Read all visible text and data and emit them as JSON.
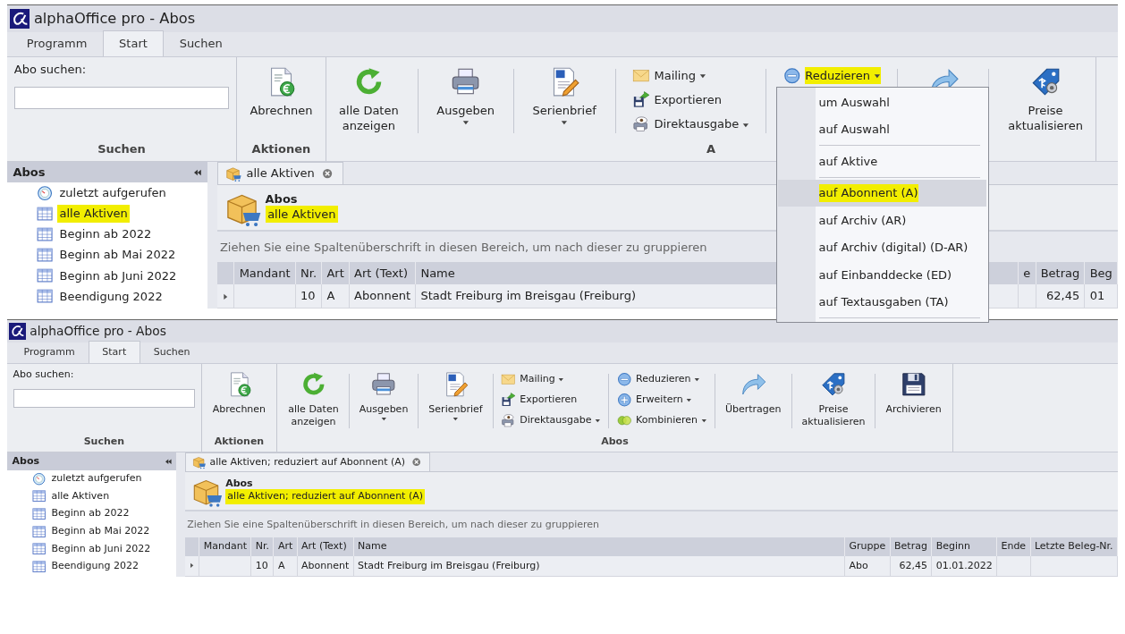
{
  "screenshots": [
    {
      "title": "alphaOffice pro - Abos",
      "tabs": [
        {
          "label": "Programm",
          "selected": false
        },
        {
          "label": "Start",
          "selected": true
        },
        {
          "label": "Suchen",
          "selected": false
        }
      ],
      "ribbon_groups": [
        {
          "label": "Suchen",
          "kind": "search",
          "field_label": "Abo suchen:"
        },
        {
          "label": "Aktionen",
          "kind": "buttons",
          "sections": [
            {
              "kind": "large",
              "label": "Abrechnen",
              "dropdown": false
            }
          ]
        },
        {
          "label": "A",
          "kind": "buttons",
          "sections": [
            {
              "kind": "large",
              "label": "alle Daten\nanzeigen",
              "dropdown": false
            },
            {
              "kind": "large",
              "label": "Ausgeben",
              "dropdown": true
            },
            {
              "kind": "large",
              "label": "Serienbrief",
              "dropdown": true
            },
            {
              "kind": "small_stack",
              "items": [
                {
                  "label": "Mailing",
                  "dropdown": true,
                  "highlighted": false
                },
                {
                  "label": "Exportieren",
                  "dropdown": false,
                  "highlighted": false
                },
                {
                  "label": "Direktausgabe",
                  "dropdown": true,
                  "highlighted": false
                }
              ]
            },
            {
              "kind": "small_stack",
              "items": [
                {
                  "label": "Reduzieren",
                  "dropdown": true,
                  "highlighted": true,
                  "menu": [
                    {
                      "kind": "item",
                      "label": "um Auswahl",
                      "selected": false,
                      "highlighted": false
                    },
                    {
                      "kind": "item",
                      "label": "auf Auswahl",
                      "selected": false,
                      "highlighted": false
                    },
                    {
                      "kind": "separator"
                    },
                    {
                      "kind": "item",
                      "label": "auf Aktive",
                      "selected": false,
                      "highlighted": false
                    },
                    {
                      "kind": "separator"
                    },
                    {
                      "kind": "item",
                      "label": "auf Abonnent (A)",
                      "selected": true,
                      "highlighted": true
                    },
                    {
                      "kind": "item",
                      "label": "auf Archiv (AR)",
                      "selected": false,
                      "highlighted": false
                    },
                    {
                      "kind": "item",
                      "label": "auf Archiv (digital) (D-AR)",
                      "selected": false,
                      "highlighted": false
                    },
                    {
                      "kind": "item",
                      "label": "auf Einbanddecke (ED)",
                      "selected": false,
                      "highlighted": false
                    },
                    {
                      "kind": "item",
                      "label": "auf Textausgaben (TA)",
                      "selected": false,
                      "highlighted": false
                    },
                    {
                      "kind": "separator"
                    }
                  ]
                }
              ]
            },
            {
              "kind": "large",
              "dropdown": false
            },
            {
              "kind": "large",
              "label": "Preise\naktualisieren",
              "dropdown": false
            }
          ]
        }
      ],
      "sidebar": {
        "title": "Abos",
        "items": [
          {
            "kind": "recent",
            "label": "zuletzt aufgerufen",
            "highlighted": false
          },
          {
            "kind": "view",
            "label": "alle Aktiven",
            "highlighted": true
          },
          {
            "kind": "view",
            "label": "Beginn ab 2022",
            "highlighted": false
          },
          {
            "kind": "view",
            "label": "Beginn ab Mai 2022",
            "highlighted": false
          },
          {
            "kind": "view",
            "label": "Beginn ab Juni 2022",
            "highlighted": false
          },
          {
            "kind": "view",
            "label": "Beendigung 2022",
            "highlighted": false
          }
        ]
      },
      "document_tab": {
        "label": "alle Aktiven"
      },
      "header": {
        "title": "Abos",
        "subtitle": "alle Aktiven",
        "highlighted": true
      },
      "group_hint": "Ziehen Sie eine Spaltenüberschrift in diesen Bereich, um nach dieser zu gruppieren",
      "table": {
        "columns": [
          {
            "label": "Mandant"
          },
          {
            "label": "Nr."
          },
          {
            "label": "Art"
          },
          {
            "label": "Art (Text)"
          },
          {
            "label": "Name"
          },
          {
            "label": "e"
          },
          {
            "label": "Betrag",
            "numeric": true
          },
          {
            "label": "Beg"
          }
        ],
        "rows": [
          {
            "current": true,
            "cells": [
              null,
              "10",
              "A",
              "Abonnent",
              "Stadt Freiburg im Breisgau (Freiburg)",
              null,
              "62,45",
              "01"
            ]
          }
        ]
      }
    },
    {
      "title": "alphaOffice pro - Abos",
      "tabs": [
        {
          "label": "Programm",
          "selected": false
        },
        {
          "label": "Start",
          "selected": true
        },
        {
          "label": "Suchen",
          "selected": false
        }
      ],
      "ribbon_groups": [
        {
          "label": "Suchen",
          "kind": "search",
          "field_label": "Abo suchen:"
        },
        {
          "label": "Aktionen",
          "kind": "buttons",
          "sections": [
            {
              "kind": "large",
              "label": "Abrechnen",
              "dropdown": false
            }
          ]
        },
        {
          "label": "Abos",
          "kind": "buttons",
          "sections": [
            {
              "kind": "large",
              "label": "alle Daten\nanzeigen",
              "dropdown": false
            },
            {
              "kind": "large",
              "label": "Ausgeben",
              "dropdown": true
            },
            {
              "kind": "large",
              "label": "Serienbrief",
              "dropdown": true
            },
            {
              "kind": "small_stack",
              "items": [
                {
                  "label": "Mailing",
                  "dropdown": true,
                  "highlighted": false
                },
                {
                  "label": "Exportieren",
                  "dropdown": false,
                  "highlighted": false
                },
                {
                  "label": "Direktausgabe",
                  "dropdown": true,
                  "highlighted": false
                }
              ]
            },
            {
              "kind": "small_stack",
              "items": [
                {
                  "label": "Reduzieren",
                  "dropdown": true,
                  "highlighted": false
                },
                {
                  "label": "Erweitern",
                  "dropdown": true,
                  "highlighted": false
                },
                {
                  "label": "Kombinieren",
                  "dropdown": true,
                  "highlighted": false
                }
              ]
            },
            {
              "kind": "large",
              "label": "Übertragen",
              "dropdown": false
            },
            {
              "kind": "large",
              "label": "Preise\naktualisieren",
              "dropdown": false
            },
            {
              "kind": "large",
              "label": "Archivieren",
              "dropdown": false
            }
          ]
        }
      ],
      "sidebar": {
        "title": "Abos",
        "items": [
          {
            "kind": "recent",
            "label": "zuletzt aufgerufen",
            "highlighted": false
          },
          {
            "kind": "view",
            "label": "alle Aktiven",
            "highlighted": false
          },
          {
            "kind": "view",
            "label": "Beginn ab 2022",
            "highlighted": false
          },
          {
            "kind": "view",
            "label": "Beginn ab Mai 2022",
            "highlighted": false
          },
          {
            "kind": "view",
            "label": "Beginn ab Juni 2022",
            "highlighted": false
          },
          {
            "kind": "view",
            "label": "Beendigung 2022",
            "highlighted": false
          }
        ]
      },
      "document_tab": {
        "label": "alle Aktiven; reduziert auf Abonnent (A)"
      },
      "header": {
        "title": "Abos",
        "subtitle": "alle Aktiven; reduziert auf Abonnent (A)",
        "highlighted": true
      },
      "group_hint": "Ziehen Sie eine Spaltenüberschrift in diesen Bereich, um nach dieser zu gruppieren",
      "table": {
        "columns": [
          {
            "label": "Mandant"
          },
          {
            "label": "Nr."
          },
          {
            "label": "Art"
          },
          {
            "label": "Art (Text)"
          },
          {
            "label": "Name"
          },
          {
            "label": "Gruppe"
          },
          {
            "label": "Betrag",
            "numeric": true
          },
          {
            "label": "Beginn"
          },
          {
            "label": "Ende"
          },
          {
            "label": "Letzte Beleg-Nr."
          }
        ],
        "rows": [
          {
            "current": true,
            "cells": [
              null,
              "10",
              "A",
              "Abonnent",
              "Stadt Freiburg im Breisgau (Freiburg)",
              "Abo",
              "62,45",
              "01.01.2022",
              null,
              null
            ]
          }
        ]
      }
    }
  ]
}
